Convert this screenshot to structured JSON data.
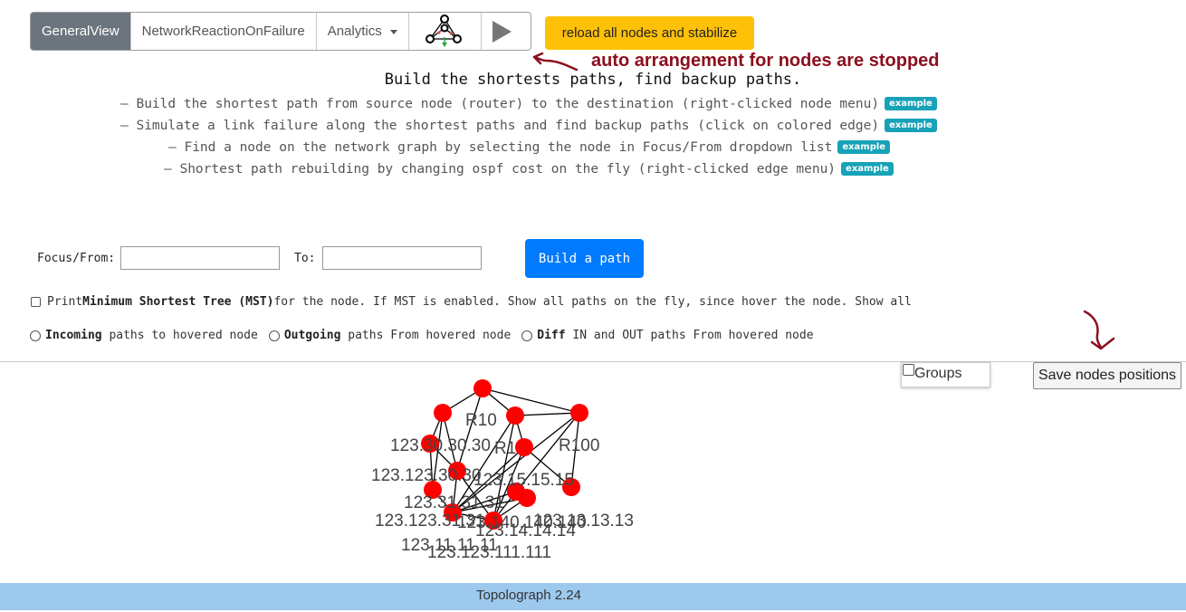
{
  "nav": {
    "tabs": [
      {
        "label": "GeneralView",
        "active": true
      },
      {
        "label": "NetworkReactionOnFailure",
        "active": false
      },
      {
        "label": "Analytics",
        "active": false,
        "dropdown": true
      }
    ],
    "topology_icon": "network-topology-icon",
    "play_icon": "play-icon"
  },
  "reload_button": "reload all nodes and stabilize",
  "annotation_note": "auto arrangement for nodes are stopped",
  "heading": "Build the shortests paths, find backup paths.",
  "bullets": [
    {
      "text": "— Build the shortest path from source node (router) to the destination (right-clicked node menu)",
      "badge": "example"
    },
    {
      "text": "— Simulate a link failure along the shortest paths and find backup paths (click on colored edge)",
      "badge": "example"
    },
    {
      "text": "— Find a node on the network graph by selecting the node in Focus/From dropdown list",
      "badge": "example"
    },
    {
      "text": "— Shortest path rebuilding by changing ospf cost on the fly (right-clicked edge menu)",
      "badge": "example"
    }
  ],
  "path_form": {
    "from_label": "Focus/From:",
    "from_value": "",
    "to_label": "To:",
    "to_value": "",
    "build_button": "Build a path"
  },
  "mst_option": {
    "checked": false,
    "prefix": "Print ",
    "bold": "Minimum Shortest Tree (MST)",
    "suffix": " for the node. If MST is enabled. Show all paths on the fly, since hover the node. Show all"
  },
  "radio_options": [
    {
      "bold": "Incoming",
      "text": " paths to hovered node"
    },
    {
      "bold": "Outgoing",
      "text": " paths From hovered node"
    },
    {
      "bold": "Diff",
      "text": " IN and OUT paths From hovered node"
    }
  ],
  "groups_toggle": {
    "label": "Groups",
    "checked": false
  },
  "save_button": "Save nodes positions",
  "graph": {
    "node_color": "#ff0000",
    "labels": [
      "R10",
      "123.30.30.30",
      "R1",
      "R100",
      "123.123.30.30",
      "123.15.15.15",
      "123.31.31.31",
      "123.123.31.31",
      "123.140.140.140",
      "123.13.13.13",
      "123.14.14.14",
      "123.11.11.11",
      "123.123.111.111"
    ]
  },
  "footer": "Topolograph 2.24",
  "colors": {
    "active_tab": "#6c757d",
    "reload": "#ffc107",
    "primary": "#007bff",
    "badge": "#17a2b8",
    "annotation": "#8b0f1e",
    "footer": "#9ec9ef"
  }
}
